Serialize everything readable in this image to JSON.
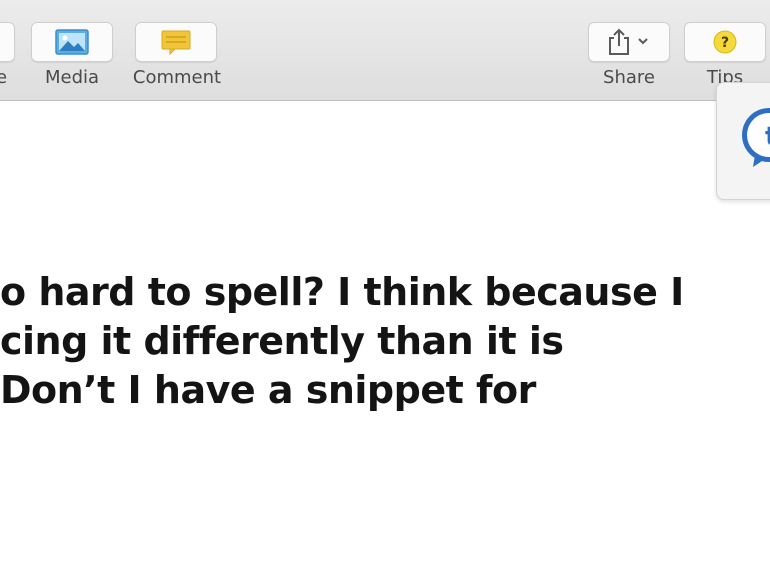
{
  "toolbar": {
    "buttons": [
      {
        "label": "e",
        "icon": "partial-button"
      },
      {
        "label": "Media",
        "icon": "image-icon"
      },
      {
        "label": "Comment",
        "icon": "comment-icon"
      },
      {
        "label": "Share",
        "icon": "share-icon"
      },
      {
        "label": "Tips",
        "icon": "help-icon"
      }
    ]
  },
  "floating_app": {
    "icon": "speech-bubble-app-icon",
    "glyph": "te"
  },
  "document": {
    "lines": [
      "o hard to spell? I think because I",
      "cing it differently than it is",
      "Don’t I have a snippet for"
    ]
  },
  "colors": {
    "toolbar_bg": "#e4e4e4",
    "comment_yellow": "#f0c53a",
    "media_blue": "#4aa3df",
    "tips_yellow": "#f5d83a",
    "app_blue": "#2f6fc1"
  }
}
